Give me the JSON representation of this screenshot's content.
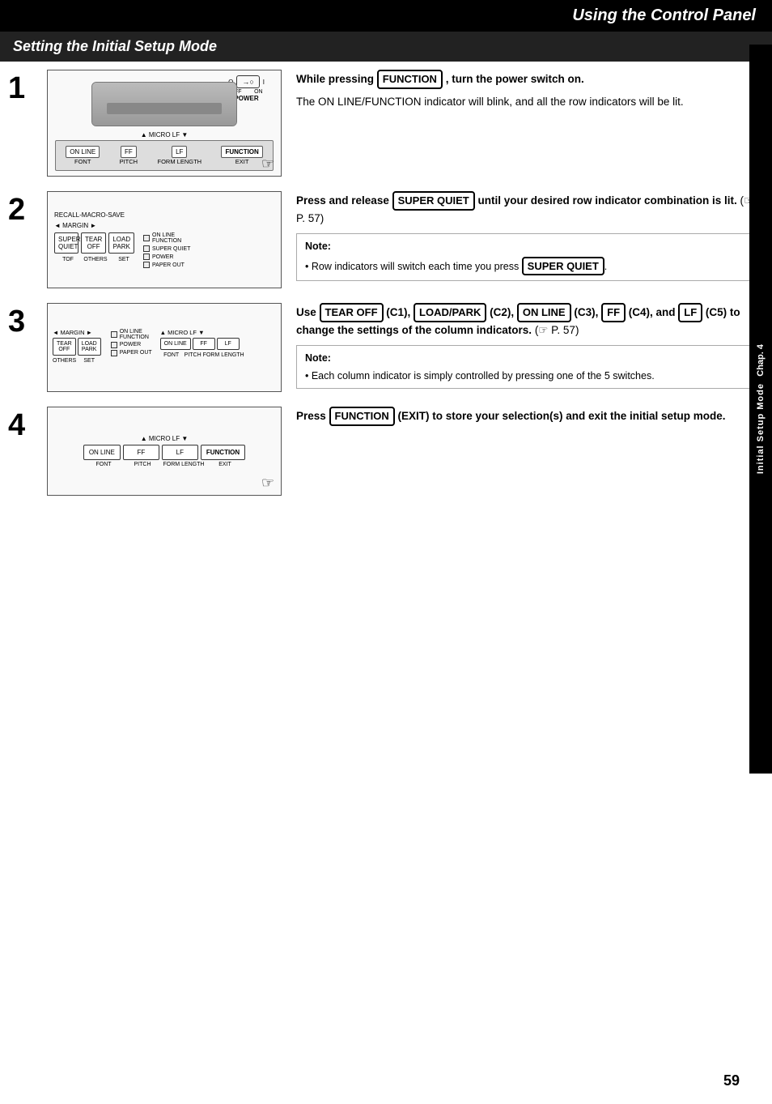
{
  "header": {
    "title": "Using the Control Panel"
  },
  "section": {
    "title": "Setting the Initial Setup Mode"
  },
  "sidebar": {
    "chap_label": "Chap. 4",
    "section_label": "Initial Setup Mode"
  },
  "page_number": "59",
  "steps": [
    {
      "number": "1",
      "instruction": "While pressing",
      "button": "FUNCTION",
      "instruction2": ", turn the power switch on.",
      "detail": "The ON LINE/FUNCTION indicator will blink, and all the row indicators will be lit.",
      "has_note": false
    },
    {
      "number": "2",
      "instruction": "Press and release",
      "button": "SUPER QUIET",
      "instruction2": "until your desired row indicator combination is lit.",
      "page_ref": "(☞ P. 57)",
      "note_title": "Note:",
      "note_text": "• Row indicators will switch each time you press",
      "note_button": "SUPER QUIET",
      "has_note": true
    },
    {
      "number": "3",
      "instruction_parts": [
        "Use",
        "TEAR OFF",
        "(C1),",
        "LOAD/PARK",
        "(C2),",
        "ON LINE",
        "(C3),",
        "FF",
        "(C4), and",
        "LF",
        "(C5) to change the settings of the column indicators."
      ],
      "page_ref": "(☞ P. 57)",
      "note_title": "Note:",
      "note_text": "• Each column indicator is simply controlled by pressing one of the 5 switches.",
      "has_note": true
    },
    {
      "number": "4",
      "instruction": "Press",
      "button": "FUNCTION",
      "instruction2": "(EXIT) to store your selection(s) and exit the initial setup mode.",
      "has_note": false
    }
  ],
  "buttons": {
    "function": "FUNCTION",
    "super_quiet": "SUPER QUIET",
    "tear_off": "TEAR OFF",
    "load_park": "LOAD/PARK",
    "on_line": "ON LINE",
    "ff": "FF",
    "lf": "LF"
  },
  "diagram_labels": {
    "power": "POWER",
    "off": "OFF",
    "on": "ON",
    "micro_lf": "▲ MICRO LF ▼",
    "on_line": "ON LINE",
    "ff": "FF",
    "lf": "LF",
    "function": "FUNCTION",
    "font": "FONT",
    "pitch": "PITCH",
    "form_length": "FORM LENGTH",
    "exit": "EXIT",
    "recall_macro_save": "RECALL-MACRO-SAVE",
    "margin": "◄ MARGIN ►",
    "super_quiet": "SUPER",
    "quiet": "QUIET",
    "tear": "TEAR",
    "tear_off_label": "OFF",
    "load": "LOAD",
    "park": "PARK",
    "tof": "TOF",
    "others": "OTHERS",
    "set": "SET",
    "on_line_function": "ON LINE\nFUNCTION",
    "super_quiet_led": "SUPER QUIET",
    "power_led": "POWER",
    "paper_out": "PAPER OUT"
  }
}
